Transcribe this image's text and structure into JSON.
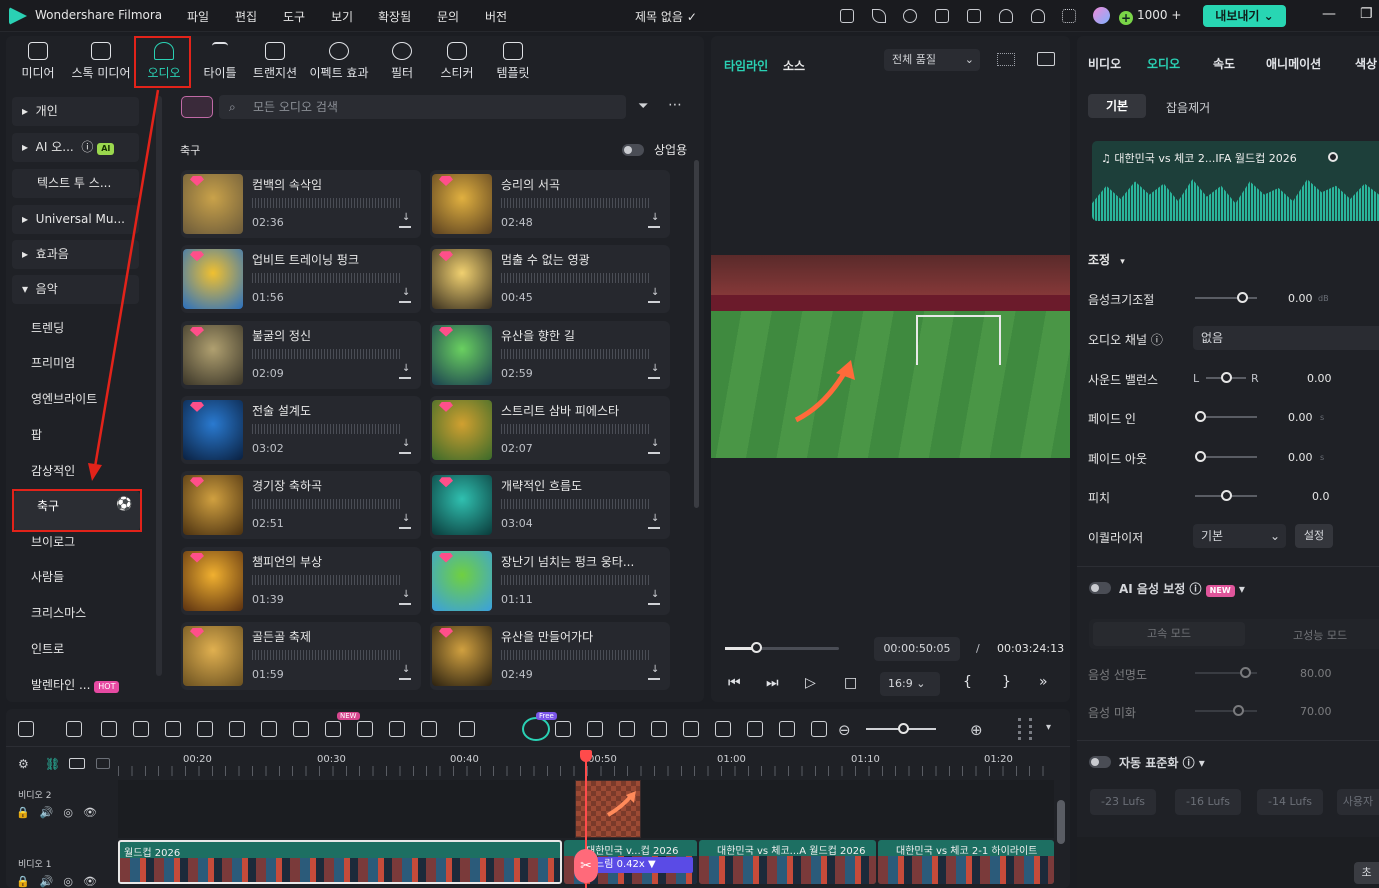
{
  "app": {
    "title": "Wondershare Filmora",
    "project": "제목 없음",
    "credits": "1000",
    "export_label": "내보내기"
  },
  "menu": [
    "파일",
    "편집",
    "도구",
    "보기",
    "확장됨",
    "문의",
    "버전"
  ],
  "media_tabs": [
    {
      "label": "미디어",
      "icon": "media-icon"
    },
    {
      "label": "스톡 미디어",
      "icon": "stock-media-icon"
    },
    {
      "label": "오디오",
      "icon": "music-note-icon",
      "active": true
    },
    {
      "label": "타이틀",
      "icon": "title-icon"
    },
    {
      "label": "트랜지션",
      "icon": "transition-icon"
    },
    {
      "label": "이펙트 효과",
      "icon": "effects-icon"
    },
    {
      "label": "필터",
      "icon": "filter-icon"
    },
    {
      "label": "스티커",
      "icon": "sticker-icon"
    },
    {
      "label": "템플릿",
      "icon": "template-icon"
    }
  ],
  "sidebar": {
    "groups": [
      {
        "label": "개인"
      },
      {
        "label": "AI 오...",
        "badge": "AI"
      },
      {
        "label": "텍스트 투 스..."
      },
      {
        "label": "Universal Mu..."
      },
      {
        "label": "효과음"
      },
      {
        "label": "음악"
      }
    ],
    "music_items": [
      "트렌딩",
      "프리미엄",
      "영엔브라이트",
      "팝",
      "감상적인",
      "축구",
      "브이로그",
      "사람들",
      "크리스마스",
      "인트로",
      "발렌타인 ..."
    ],
    "hot_badge": "HOT"
  },
  "search": {
    "placeholder": "모든 오디오 검색"
  },
  "category_title": "축구",
  "commercial_label": "상업용",
  "tracks": [
    {
      "name": "컴백의 속삭임",
      "duration": "02:36"
    },
    {
      "name": "승리의 서곡",
      "duration": "02:48"
    },
    {
      "name": "업비트 트레이닝 펑크",
      "duration": "01:56"
    },
    {
      "name": "멈출 수 없는 영광",
      "duration": "00:45"
    },
    {
      "name": "불굴의 정신",
      "duration": "02:09"
    },
    {
      "name": "유산을 향한 길",
      "duration": "02:59"
    },
    {
      "name": "전술 설계도",
      "duration": "03:02"
    },
    {
      "name": "스트리트 삼바 피에스타",
      "duration": "02:07"
    },
    {
      "name": "경기장 축하곡",
      "duration": "02:51"
    },
    {
      "name": "개략적인 흐름도",
      "duration": "03:04"
    },
    {
      "name": "챔피언의 부상",
      "duration": "01:39"
    },
    {
      "name": "장난기 넘치는 펑크 웅타...",
      "duration": "01:11"
    },
    {
      "name": "골든골 축제",
      "duration": "01:59"
    },
    {
      "name": "유산을 만들어가다",
      "duration": "02:49"
    }
  ],
  "preview": {
    "tab_timeline": "타임라인",
    "tab_source": "소스",
    "quality": "전체 품질",
    "current_time": "00:00:50:05",
    "separator": "/",
    "total_time": "00:03:24:13",
    "aspect": "16:9",
    "scrub_progress": 0.27
  },
  "inspector": {
    "tabs": [
      "비디오",
      "오디오",
      "속도",
      "애니메이션",
      "색상"
    ],
    "subtabs": [
      "기본",
      "잡음제거"
    ],
    "clip_name": "대한민국 vs 체코 2...IFA 월드컵 2026",
    "section_adjust": "조정",
    "rows": [
      {
        "label": "음성크기조절",
        "value": "0.00",
        "unit": "dB",
        "level": 0.75
      },
      {
        "label": "오디오 채널",
        "value": "없음"
      },
      {
        "label": "사운드 밸런스",
        "left": "L",
        "right": "R",
        "value": "0.00",
        "level": 0.5
      },
      {
        "label": "페이드 인",
        "value": "0.00",
        "unit": "s",
        "level": 0.0
      },
      {
        "label": "페이드 아웃",
        "value": "0.00",
        "unit": "s",
        "level": 0.0
      },
      {
        "label": "피치",
        "value": "0.0",
        "level": 0.5
      },
      {
        "label": "이퀄라이저",
        "value": "기본",
        "button": "설정"
      }
    ],
    "ai_voice": {
      "label": "AI 음성 보정",
      "badge": "NEW",
      "modes": [
        "고속 모드",
        "고성능 모드"
      ],
      "clarity_label": "음성 선명도",
      "clarity_value": "80.00",
      "clarity_level": 0.8,
      "beauty_label": "음성 미화",
      "beauty_value": "70.00",
      "beauty_level": 0.7
    },
    "auto_normalize": {
      "label": "자동 표준화",
      "presets": [
        "-23 Lufs",
        "-16 Lufs",
        "-14 Lufs",
        "사용자"
      ]
    },
    "reset_label": "초"
  },
  "timeline": {
    "ruler": [
      "00:20",
      "00:30",
      "00:40",
      "00:50",
      "01:00",
      "01:10",
      "01:20"
    ],
    "tracks": [
      "비디오 2",
      "비디오 1"
    ],
    "clips": [
      {
        "title": "월드컵 2026"
      },
      {
        "title": "대한민국 v...컵 2026"
      },
      {
        "title": "대한민국 vs 체코...A 월드컵 2026"
      },
      {
        "title": "대한민국 vs 체코 2-1 하이라이트"
      }
    ],
    "speed_label": "느림 0.42x",
    "free_badge": "Free",
    "new_badge": "NEW"
  },
  "colors": {
    "accent": "#2ad1b4",
    "highlight": "#e2231a",
    "playhead": "#ff4b4b"
  }
}
